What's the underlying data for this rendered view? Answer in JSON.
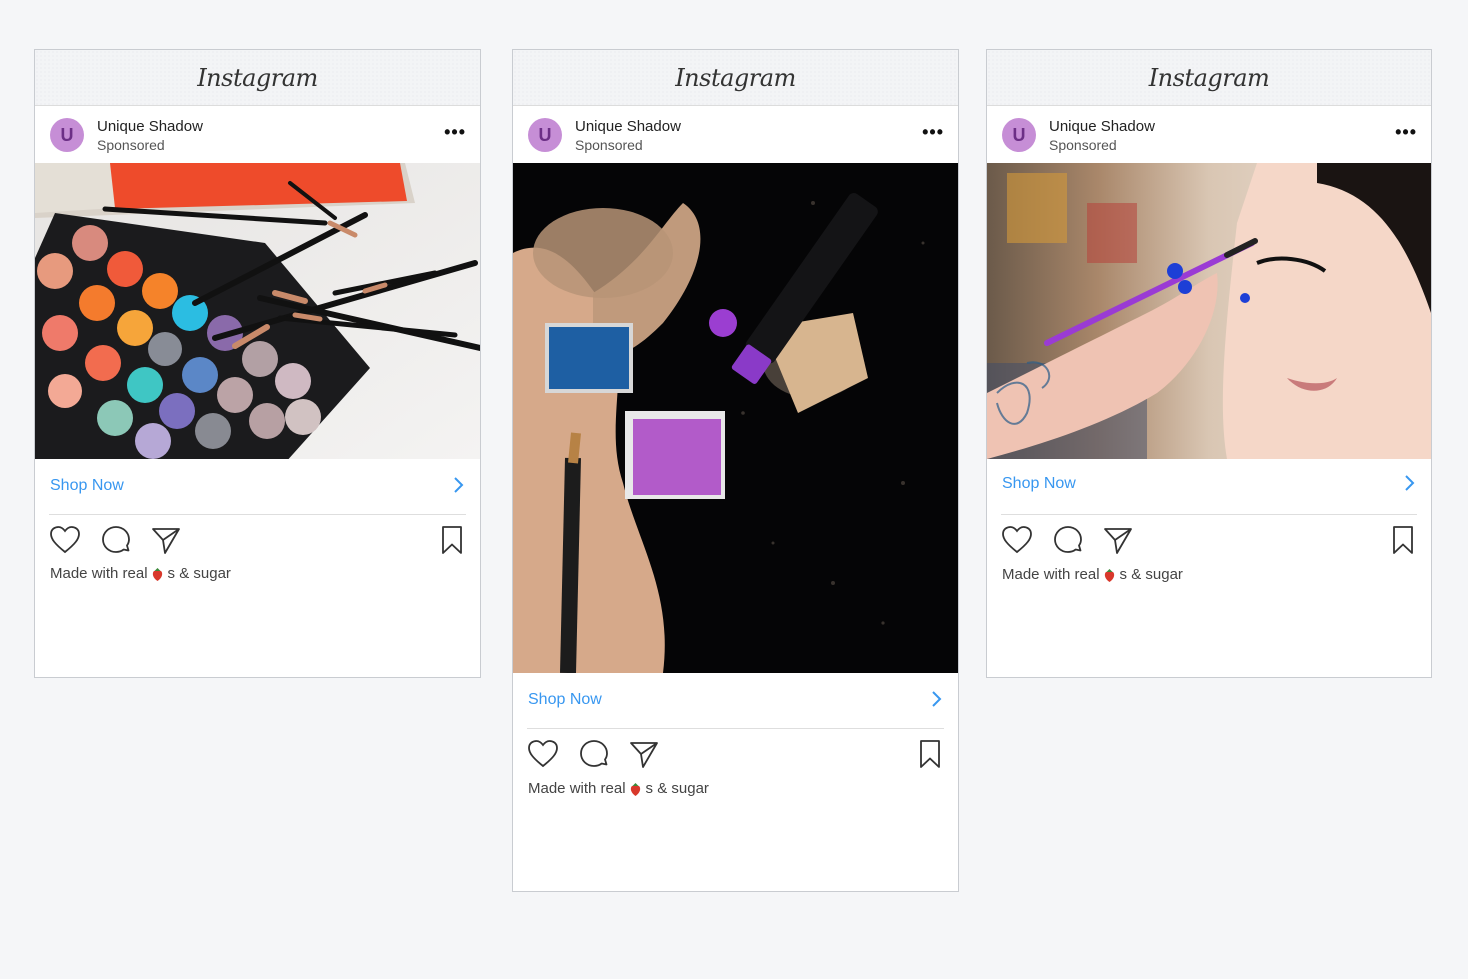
{
  "posts": [
    {
      "brand": "Instagram",
      "account_name": "Unique Shadow",
      "account_initial": "U",
      "sponsored_label": "Sponsored",
      "more_label": "•••",
      "cta_label": "Shop Now",
      "caption_before": "Made with real",
      "caption_after": "s & sugar",
      "image_subject": "eyeshadow palette and makeup brushes"
    },
    {
      "brand": "Instagram",
      "account_name": "Unique Shadow",
      "account_initial": "U",
      "sponsored_label": "Sponsored",
      "more_label": "•••",
      "cta_label": "Shop Now",
      "caption_before": "Made with real",
      "caption_after": "s & sugar",
      "image_subject": "crushed powder, eyeshadow pans and matte lip stick"
    },
    {
      "brand": "Instagram",
      "account_name": "Unique Shadow",
      "account_initial": "U",
      "sponsored_label": "Sponsored",
      "more_label": "•••",
      "cta_label": "Shop Now",
      "caption_before": "Made with real",
      "caption_after": "s & sugar",
      "image_subject": "woman applying eye makeup with purple brush"
    }
  ],
  "colors": {
    "link": "#3897f0",
    "avatar_bg": "#c68ed6",
    "avatar_text": "#6c2f86",
    "page_bg": "#f5f6f8",
    "card_border": "#c9ccd1"
  },
  "icons": [
    "heart-icon",
    "comment-icon",
    "share-icon",
    "bookmark-icon",
    "chevron-right-icon",
    "strawberry-icon",
    "more-icon"
  ]
}
